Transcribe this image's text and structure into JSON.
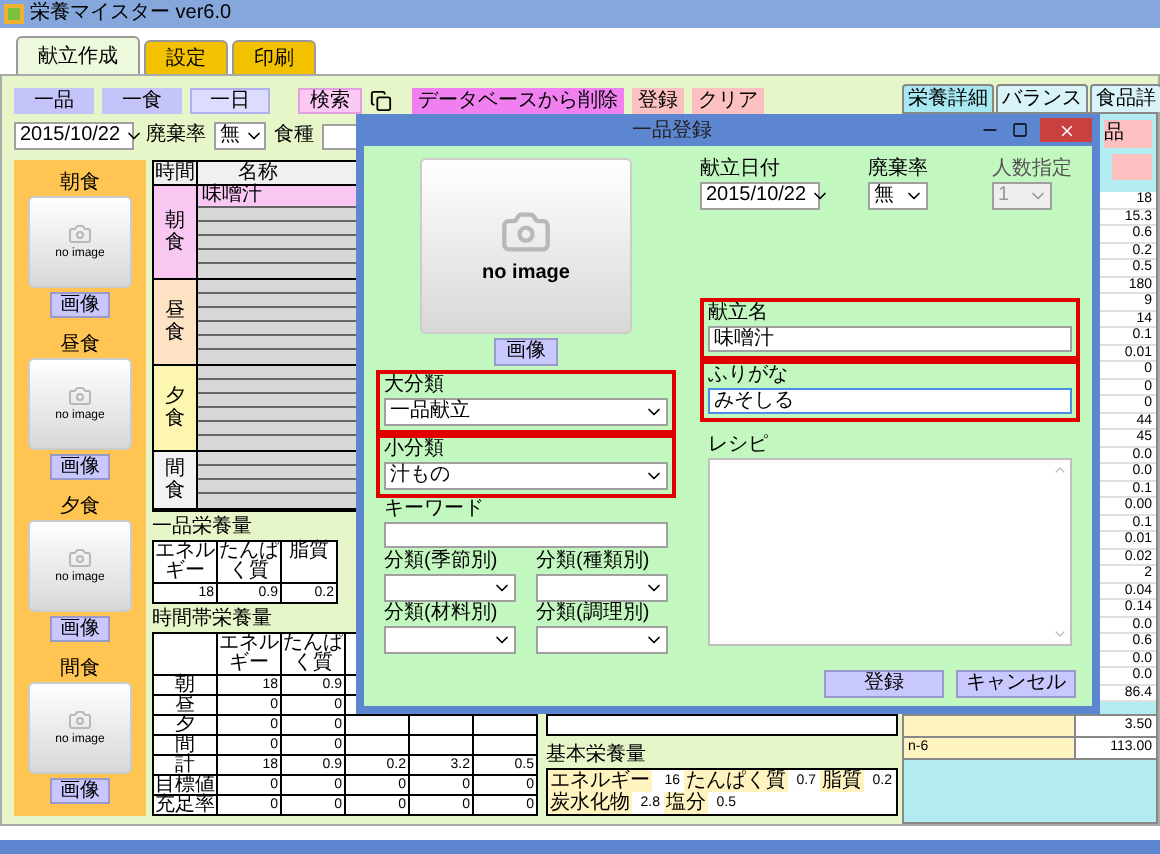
{
  "window": {
    "title": "栄養マイスター ver6.0"
  },
  "tabs": [
    {
      "label": "献立作成",
      "selected": true
    },
    {
      "label": "設定",
      "selected": false
    },
    {
      "label": "印刷",
      "selected": false
    }
  ],
  "toolbar": {
    "mode_buttons": [
      {
        "label": "一品",
        "selected": false
      },
      {
        "label": "一食",
        "selected": false
      },
      {
        "label": "一日",
        "selected": true
      }
    ],
    "search_button": "検索",
    "action_buttons": [
      {
        "label": "データベースから削除",
        "kind": "delete"
      },
      {
        "label": "登録",
        "kind": "normal"
      },
      {
        "label": "クリア",
        "kind": "normal"
      }
    ],
    "date": "2015/10/22",
    "waste_label": "廃棄率",
    "waste_value": "無",
    "diet_label": "食種"
  },
  "meals": [
    {
      "title": "朝食",
      "image_text": "no image",
      "button": "画像"
    },
    {
      "title": "昼食",
      "image_text": "no image",
      "button": "画像"
    },
    {
      "title": "夕食",
      "image_text": "no image",
      "button": "画像"
    },
    {
      "title": "間食",
      "image_text": "no image",
      "button": "画像"
    }
  ],
  "menu_grid": {
    "columns": [
      "時間",
      "名称"
    ],
    "groups": [
      {
        "label": "朝食",
        "color": "#f9c8f2",
        "items": [
          "味噌汁"
        ]
      },
      {
        "label": "昼食",
        "color": "#fde2c4"
      },
      {
        "label": "夕食",
        "color": "#fdf6b0"
      },
      {
        "label": "間食",
        "color": "#f2f2f2"
      }
    ]
  },
  "single_nutrition": {
    "title": "一品栄養量",
    "columns": [
      "エネルギー",
      "たんぱく質",
      "脂質"
    ],
    "values": [
      "18",
      "0.9",
      "0.2"
    ]
  },
  "time_nutrition": {
    "title": "時間帯栄養量",
    "columns": [
      "エネルギー",
      "たんぱく質"
    ],
    "rows": [
      {
        "label": "朝",
        "values": [
          "18",
          "0.9"
        ]
      },
      {
        "label": "昼",
        "values": [
          "0",
          "0"
        ]
      },
      {
        "label": "夕",
        "values": [
          "0",
          "0"
        ]
      },
      {
        "label": "間",
        "values": [
          "0",
          "0"
        ]
      },
      {
        "label": "計",
        "values": [
          "18",
          "0.9",
          "0.2",
          "3.2",
          "0.5"
        ]
      },
      {
        "label": "目標値",
        "values": [
          "0",
          "0",
          "0",
          "0",
          "0"
        ]
      },
      {
        "label": "充足率",
        "values": [
          "0",
          "0",
          "0",
          "0",
          "0"
        ]
      }
    ]
  },
  "basic_nutrition": {
    "title": "基本栄養量",
    "items": [
      {
        "label": "エネルギー",
        "value": "16"
      },
      {
        "label": "たんぱく質",
        "value": "0.7"
      },
      {
        "label": "脂質",
        "value": "0.2"
      },
      {
        "label": "炭水化物",
        "value": "2.8"
      },
      {
        "label": "塩分",
        "value": "0.5"
      }
    ]
  },
  "detail_tabs": [
    {
      "label": "栄養詳細",
      "selected": true
    },
    {
      "label": "バランス",
      "selected": false
    },
    {
      "label": "食品詳",
      "selected": false
    }
  ],
  "detail_button": "品",
  "detail_values": [
    "18",
    "15.3",
    "0.6",
    "0.2",
    "0.5",
    "180",
    "9",
    "14",
    "0.1",
    "0.01",
    "0",
    "0",
    "0",
    "44",
    "45",
    "0.0",
    "0.0",
    "0.1",
    "0.00",
    "0.1",
    "0.01",
    "0.02",
    "2",
    "0.04",
    "0.14",
    "0.0",
    "0.6",
    "0.0",
    "0.0",
    "86.4"
  ],
  "detail_footer": [
    {
      "value": "3.50"
    },
    {
      "label": "n-6",
      "value": "113.00"
    }
  ],
  "dialog": {
    "title": "一品登録",
    "image_text": "no image",
    "image_button": "画像",
    "date": {
      "label": "献立日付",
      "value": "2015/10/22"
    },
    "waste": {
      "label": "廃棄率",
      "value": "無"
    },
    "servings": {
      "label": "人数指定",
      "value": "1",
      "disabled": true
    },
    "menu_name": {
      "label": "献立名",
      "value": "味噌汁",
      "highlighted": true
    },
    "furigana": {
      "label": "ふりがな",
      "value": "みそしる",
      "highlighted": true,
      "focused": true
    },
    "major_category": {
      "label": "大分類",
      "value": "一品献立",
      "highlighted": true
    },
    "minor_category": {
      "label": "小分類",
      "value": "汁もの",
      "highlighted": true
    },
    "keyword": {
      "label": "キーワード"
    },
    "categories": [
      {
        "label": "分類(季節別)"
      },
      {
        "label": "分類(種類別)"
      },
      {
        "label": "分類(材料別)"
      },
      {
        "label": "分類(調理別)"
      }
    ],
    "recipe": {
      "label": "レシピ"
    },
    "buttons": [
      "登録",
      "キャンセル"
    ]
  }
}
